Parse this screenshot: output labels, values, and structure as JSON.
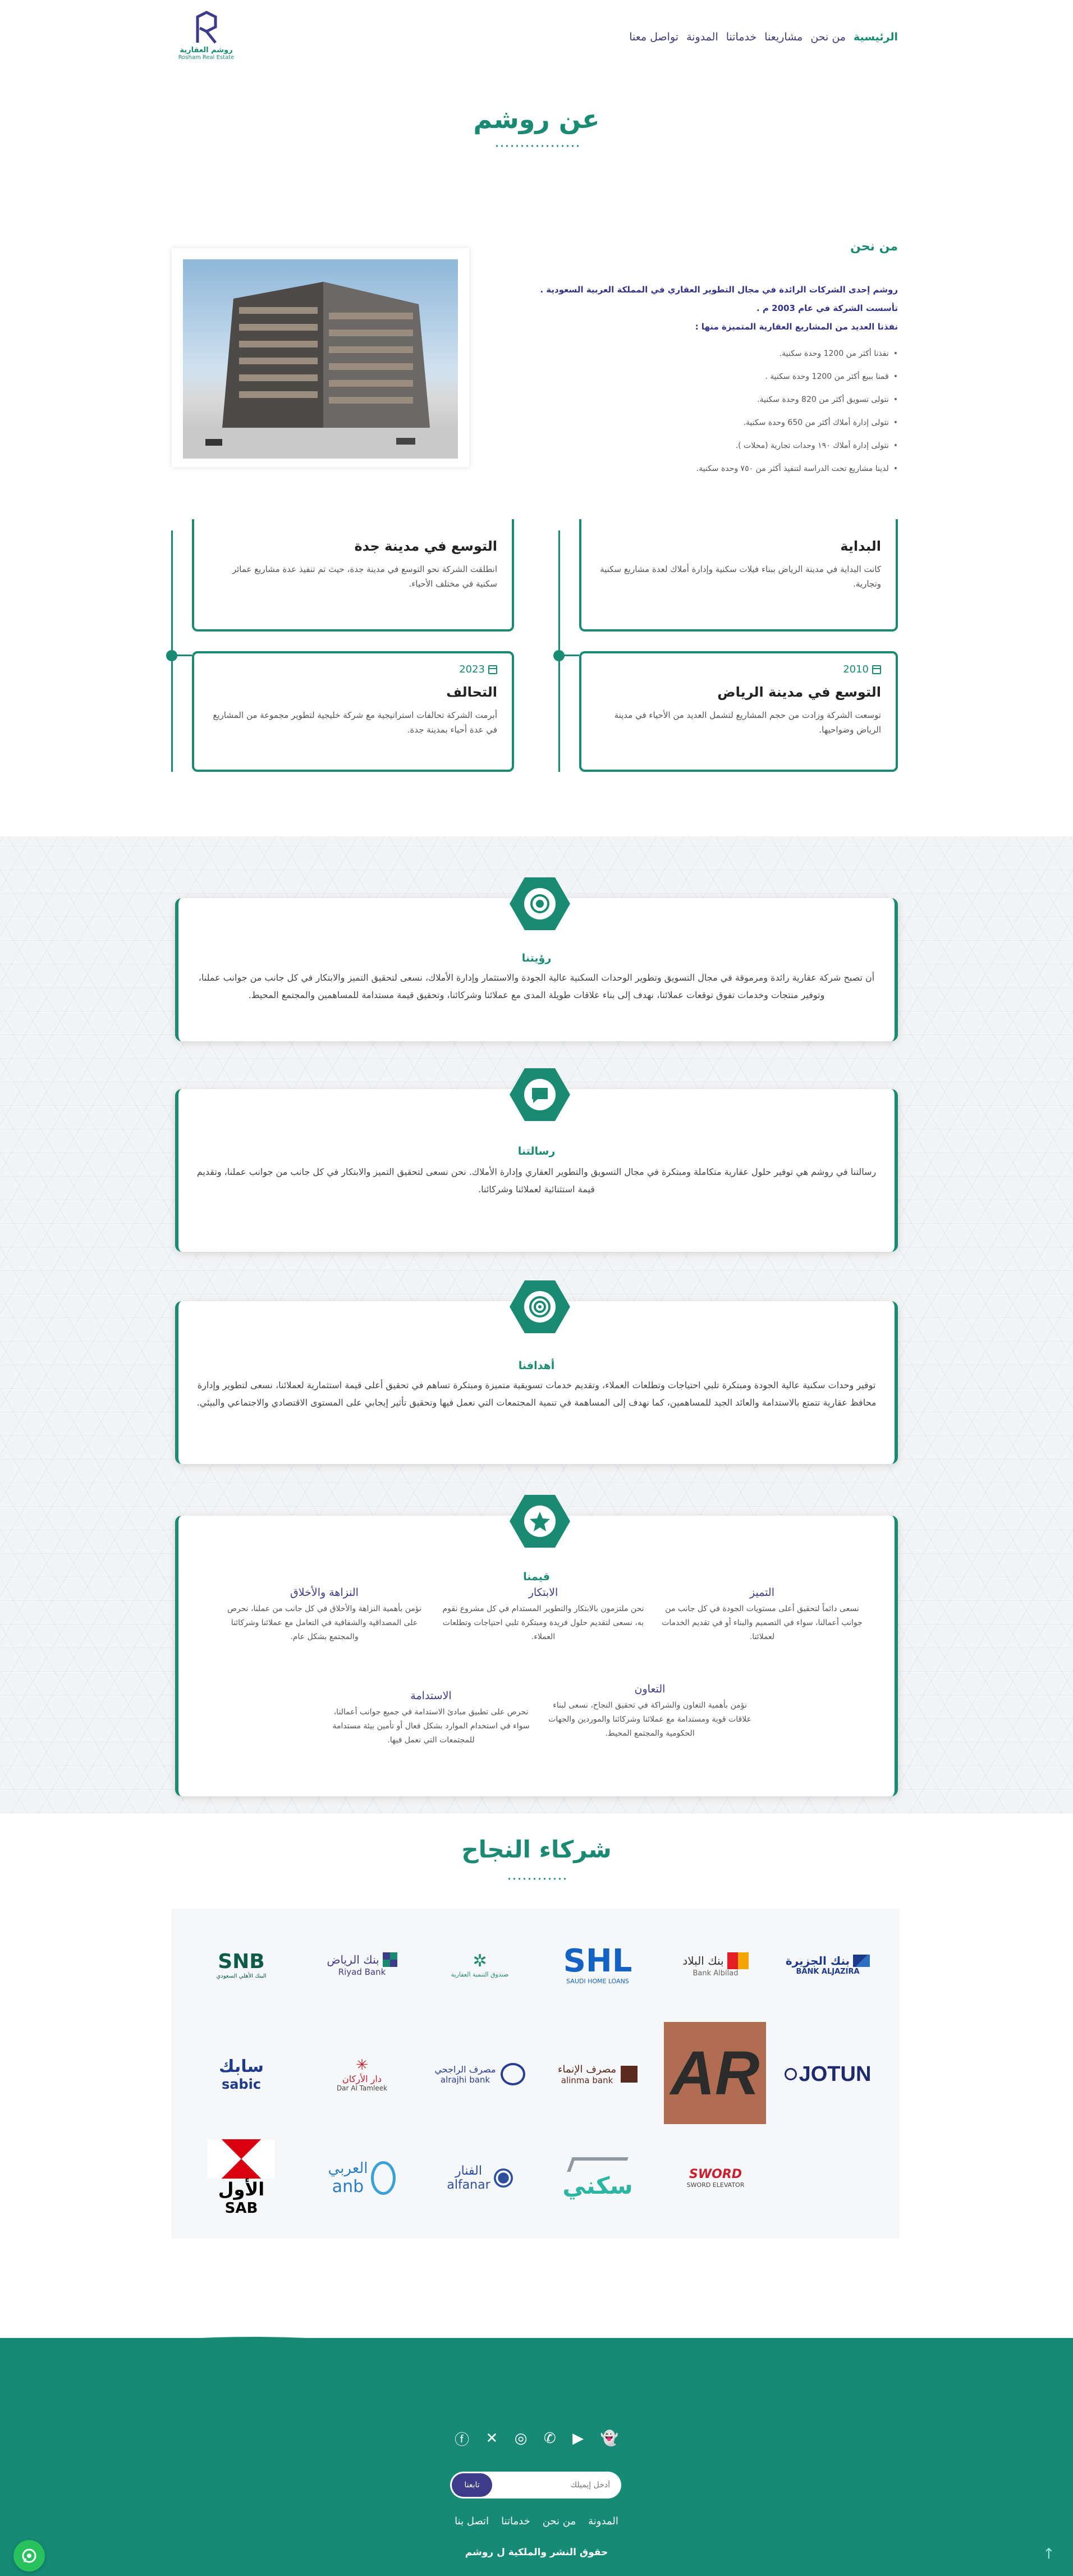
{
  "brand": {
    "name_ar": "روشم العقارية",
    "name_en": "Rosham Real Estate",
    "color": "#1a8a73",
    "navy": "#3c3c8a"
  },
  "nav": [
    "الرئيسية",
    "من نحن",
    "مشاريعنا",
    "خدماتنا",
    "المدونة",
    "تواصل معنا"
  ],
  "page_title": "عن روشم",
  "about": {
    "heading": "من نحن",
    "lines": [
      "روشم إحدى الشركات الرائدة في مجال التطوير العقاري في المملكة العربية السعودية .",
      "تأسست الشركة في عام 2003 م .",
      "نفذنا العديد من المشاريع العقارية المتميزة منها :"
    ],
    "bullets": [
      "نفذنا أكثر من 1200 وحدة سكنية.",
      "قمنا ببيع أكثر من 1200 وحدة سكنية .",
      "نتولى تسويق أكثر من 820 وحدة سكنية.",
      "نتولى إدارة أملاك أكثر من 650 وحدة سكنية.",
      "نتولى إدارة أملاك ١٩٠ وحدات تجارية (محلات ).",
      "لدينا مشاريع تحت الدراسة لتنفيذ أكثر من ٧٥٠ وحدة سكنية."
    ]
  },
  "timeline": [
    {
      "year": "",
      "title": "البداية",
      "text": "كانت البداية في مدينة الرياض ببناء فيلات سكنية وإدارة أملاك لعدة مشاريع سكنية وتجارية."
    },
    {
      "year": "",
      "title": "التوسع في مدينة جدة",
      "text": "انطلقت الشركة نحو التوسع في مدينة جدة، حيث تم تنفيذ عدة مشاريع عمائر سكنية في مختلف الأحياء."
    },
    {
      "year": "2010",
      "title": "التوسع في مدينة الرياض",
      "text": "توسعت الشركة وزادت من حجم المشاريع لتشمل العديد من الأحياء في مدينة الرياض وضواحيها."
    },
    {
      "year": "2023",
      "title": "التحالف",
      "text": "أبرمت الشركة تحالفات استراتيجية مع شركة خليجية لتطوير مجموعة من المشاريع في عدة أحياء بمدينة جدة."
    }
  ],
  "vision": {
    "title": "رؤيتنا",
    "text": "أن تصبح شركة عقارية رائدة ومرموقة في مجال التسويق وتطوير الوحدات السكنية عالية الجودة والاستثمار وإدارة الأملاك، نسعى لتحقيق التميز والابتكار في كل جانب من جوانب عملنا، وتوفير منتجات وخدمات تفوق توقعات عملائنا، نهدف إلى بناء علاقات طويلة المدى مع عملائنا وشركائنا، وتحقيق قيمة مستدامة للمساهمين والمجتمع المحيط."
  },
  "mission": {
    "title": "رسالتنا",
    "text": "رسالتنا في روشم هي توفير حلول عقارية متكاملة ومبتكرة في مجال التسويق والتطوير العقاري وإدارة الأملاك. نحن نسعى لتحقيق التميز والابتكار في كل جانب من جوانب عملنا، وتقديم قيمة استثنائية لعملائنا وشركائنا."
  },
  "goals": {
    "title": "أهدافنا",
    "text": "توفير وحدات سكنية عالية الجودة ومبتكرة تلبي احتياجات وتطلعات العملاء، وتقديم خدمات تسويقية متميزة ومبتكرة تساهم في تحقيق أعلى قيمة استثمارية لعملائنا، نسعى لتطوير وإدارة محافظ عقارية تتمتع بالاستدامة والعائد الجيد للمساهمين، كما نهدف إلى المساهمة في تنمية المجتمعات التي نعمل فيها وتحقيق تأثير إيجابي على المستوى الاقتصادي والاجتماعي والبيئي."
  },
  "values": {
    "title": "قيمنا",
    "items": [
      {
        "name": "التميز",
        "text": "نسعى دائماً لتحقيق أعلى مستويات الجودة في كل جانب من جوانب أعمالنا، سواء في التصميم والبناء أو في تقديم الخدمات لعملائنا."
      },
      {
        "name": "الابتكار",
        "text": "نحن ملتزمون بالابتكار والتطوير المستدام في كل مشروع نقوم به، نسعى لتقديم حلول فريدة ومبتكرة تلبي احتياجات وتطلعات العملاء."
      },
      {
        "name": "النزاهة والأخلاق",
        "text": "نؤمن بأهمية النزاهة والأخلاق في كل جانب من عملنا، نحرص على المصداقية والشفافية في التعامل مع عملائنا وشركائنا والمجتمع بشكل عام."
      },
      {
        "name": "التعاون",
        "text": "نؤمن بأهمية التعاون والشراكة في تحقيق النجاح، نسعى لبناء علاقات قوية ومستدامة مع عملائنا وشركائنا والموردين والجهات الحكومية والمجتمع المحيط."
      },
      {
        "name": "الاستدامة",
        "text": "نحرص على تطبيق مبادئ الاستدامة في جميع جوانب أعمالنا، سواء في استخدام الموارد بشكل فعال أو تأمين بيئة مستدامة للمجتمعات التي نعمل فيها."
      }
    ]
  },
  "partners": {
    "title": "شركاء النجاح",
    "row1": [
      {
        "ar": "بنك الجزيرة",
        "en": "BANK ALJAZIRA"
      },
      {
        "ar": "بنك البلاد",
        "en": "Bank Albilad"
      },
      {
        "ar": "SHL",
        "en": "SAUDI HOME LOANS"
      },
      {
        "ar": "صندوق التنمية العقارية",
        "en": ""
      },
      {
        "ar": "بنك الرياض",
        "en": "Riyad Bank"
      },
      {
        "ar": "SNB",
        "en": "البنك الأهلي السعودي"
      }
    ],
    "row2": [
      {
        "ar": "",
        "en": "JOTUN"
      },
      {
        "ar": "",
        "en": "AR"
      },
      {
        "ar": "مصرف الإنماء",
        "en": "alinma bank"
      },
      {
        "ar": "مصرف الراجحي",
        "en": "alrajhi bank"
      },
      {
        "ar": "دار الأركان",
        "en": "Dar Al Tamleek"
      },
      {
        "ar": "سابك",
        "en": "sabic"
      }
    ],
    "row3": [
      {
        "ar": "",
        "en": "SWORD",
        "sub": "SWORD ELEVATOR"
      },
      {
        "ar": "سكني",
        "en": ""
      },
      {
        "ar": "الفنار",
        "en": "alfanar"
      },
      {
        "ar": "العربي",
        "en": "anb"
      },
      {
        "ar": "الأول",
        "en": "SAB"
      }
    ]
  },
  "footer": {
    "social": [
      "snapchat-icon",
      "youtube-icon",
      "whatsapp-icon",
      "instagram-icon",
      "x-icon",
      "facebook-icon"
    ],
    "email_placeholder": "أدخل إيميلك",
    "subscribe": "تابعنا",
    "links": [
      "المدونة",
      "من نحن",
      "خدماتنا",
      "اتصل بنا"
    ],
    "copyright": "حقوق النشر والملكية ل روشم"
  }
}
